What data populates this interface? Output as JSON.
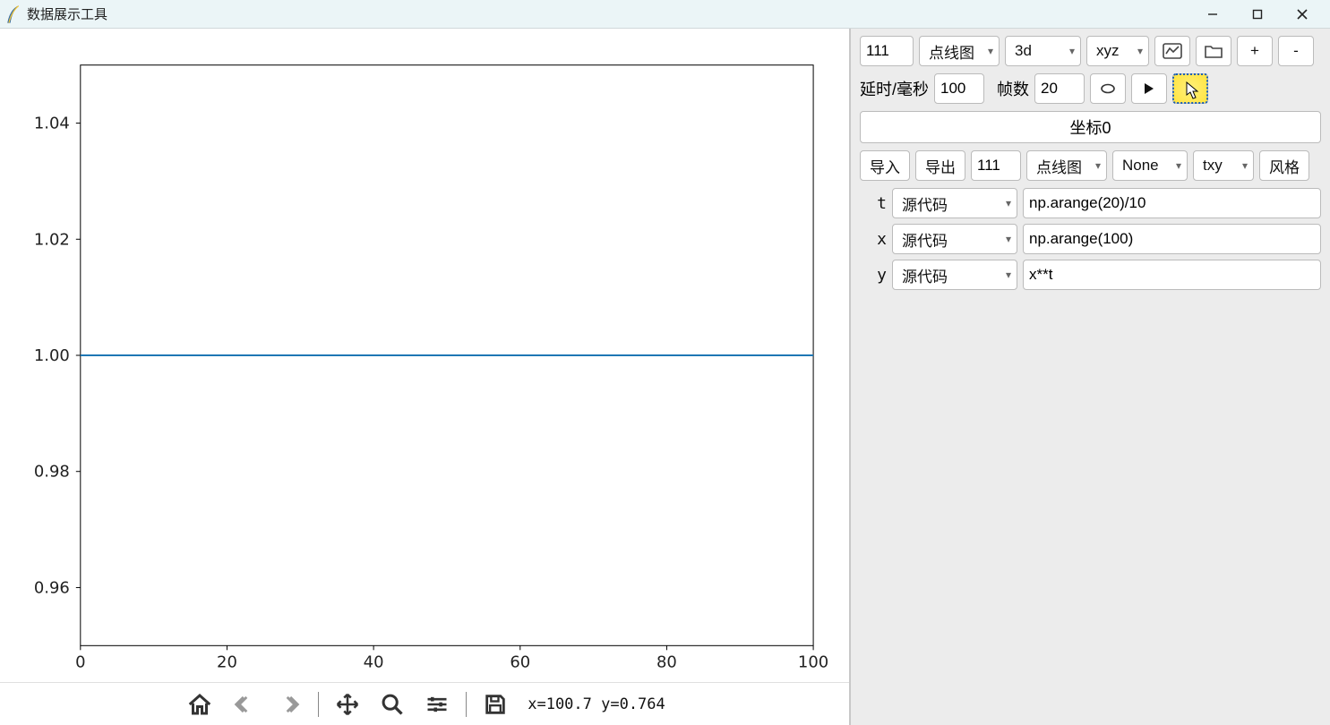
{
  "window": {
    "title": "数据展示工具"
  },
  "chart_data": {
    "type": "line",
    "x": [
      0,
      100
    ],
    "y": [
      1.0,
      1.0
    ],
    "xlim": [
      0,
      100
    ],
    "ylim": [
      0.95,
      1.05
    ],
    "xticks": [
      0,
      20,
      40,
      60,
      80,
      100
    ],
    "yticks": [
      0.96,
      0.98,
      1.0,
      1.02,
      1.04
    ],
    "ytick_labels": [
      "0.96",
      "0.98",
      "1.00",
      "1.02",
      "1.04"
    ],
    "line_color": "#1f77b4"
  },
  "mpl_toolbar": {
    "coord_text": "x=100.7 y=0.764"
  },
  "top_controls": {
    "subplot_code": "111",
    "plot_type": "点线图",
    "dimension": "3d",
    "axes_mode": "xyz",
    "plus": "+",
    "minus": "-"
  },
  "anim": {
    "delay_label": "延时/毫秒",
    "delay_value": "100",
    "frames_label": "帧数",
    "frames_value": "20"
  },
  "coord_section": {
    "label": "坐标0"
  },
  "io": {
    "import": "导入",
    "export": "导出",
    "subplot_code": "111",
    "plot_type": "点线图",
    "option_none": "None",
    "axes_mode": "txy",
    "style": "风格"
  },
  "vars": {
    "t": {
      "label": "t",
      "source": "源代码",
      "expr": "np.arange(20)/10"
    },
    "x": {
      "label": "x",
      "source": "源代码",
      "expr": "np.arange(100)"
    },
    "y": {
      "label": "y",
      "source": "源代码",
      "expr": "x**t"
    }
  }
}
